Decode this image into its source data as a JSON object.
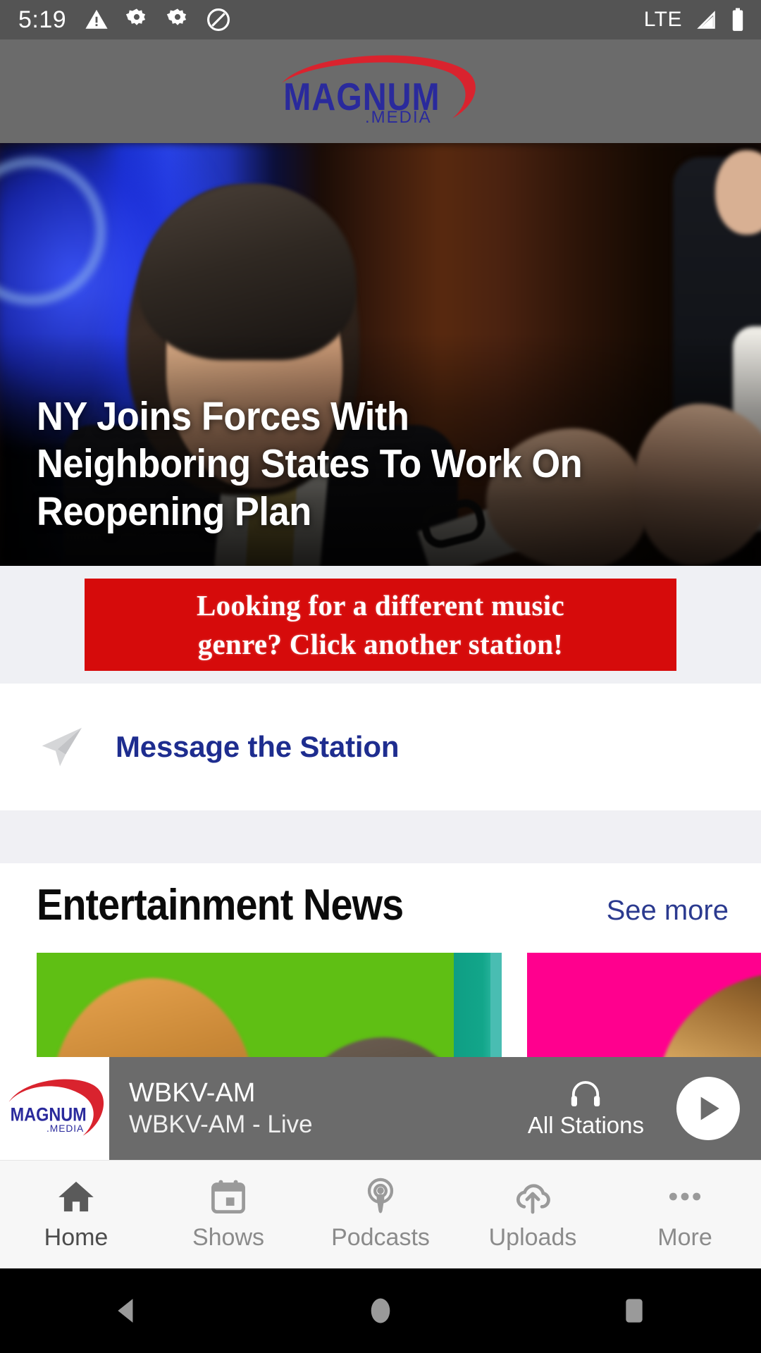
{
  "status_bar": {
    "time": "5:19",
    "network": "LTE",
    "icons": [
      "warning-triangle-icon",
      "gear-icon",
      "gear-icon",
      "do-not-disturb-icon"
    ],
    "right_icons": [
      "signal-bars-icon",
      "battery-icon"
    ],
    "background_color": "#545454"
  },
  "app_header": {
    "logo_primary": "MAGNUM",
    "logo_secondary": ".MEDIA",
    "logo_text_color": "#2A2A9C",
    "logo_swoosh_color": "#D9232E",
    "background_color": "#6B6B6B"
  },
  "hero": {
    "headline": "NY Joins Forces With Neighboring States To Work On Reopening Plan",
    "text_color": "#FFFFFF"
  },
  "banner_ad": {
    "line1": "Looking for a different music",
    "line2": "genre?  Click another station!",
    "background_color": "#D60B0B",
    "text_color": "#FFFFFF",
    "section_background": "#EFF0F4"
  },
  "message_station": {
    "label": "Message the Station",
    "icon": "paper-plane-icon",
    "text_color": "#1E2D8F"
  },
  "news_section": {
    "title": "Entertainment News",
    "see_more_label": "See more",
    "see_more_color": "#2B3A8F",
    "cards": [
      {
        "name": "news-card-1",
        "accent_color": "#5FBF14"
      },
      {
        "name": "news-card-2",
        "accent_color": "#FF008E"
      }
    ]
  },
  "mini_player": {
    "station_name": "WBKV-AM",
    "now_playing": "WBKV-AM - Live",
    "all_stations_label": "All Stations",
    "all_stations_icon": "headphones-icon",
    "play_icon": "play-icon",
    "background_color": "#6B6B6B",
    "artwork_logo_primary": "MAGNUM",
    "artwork_logo_secondary": ".MEDIA"
  },
  "bottom_nav": {
    "items": [
      {
        "label": "Home",
        "icon": "home-icon",
        "active": true
      },
      {
        "label": "Shows",
        "icon": "calendar-icon",
        "active": false
      },
      {
        "label": "Podcasts",
        "icon": "podcast-icon",
        "active": false
      },
      {
        "label": "Uploads",
        "icon": "cloud-upload-icon",
        "active": false
      },
      {
        "label": "More",
        "icon": "more-dots-icon",
        "active": false
      }
    ],
    "background_color": "#F7F7F7",
    "active_color": "#4C4C4C",
    "inactive_color": "#8B8B8B"
  },
  "android_nav": {
    "buttons": [
      "back-icon",
      "home-circle-icon",
      "recents-square-icon"
    ],
    "background_color": "#000000",
    "icon_color": "#9A9A9A"
  }
}
